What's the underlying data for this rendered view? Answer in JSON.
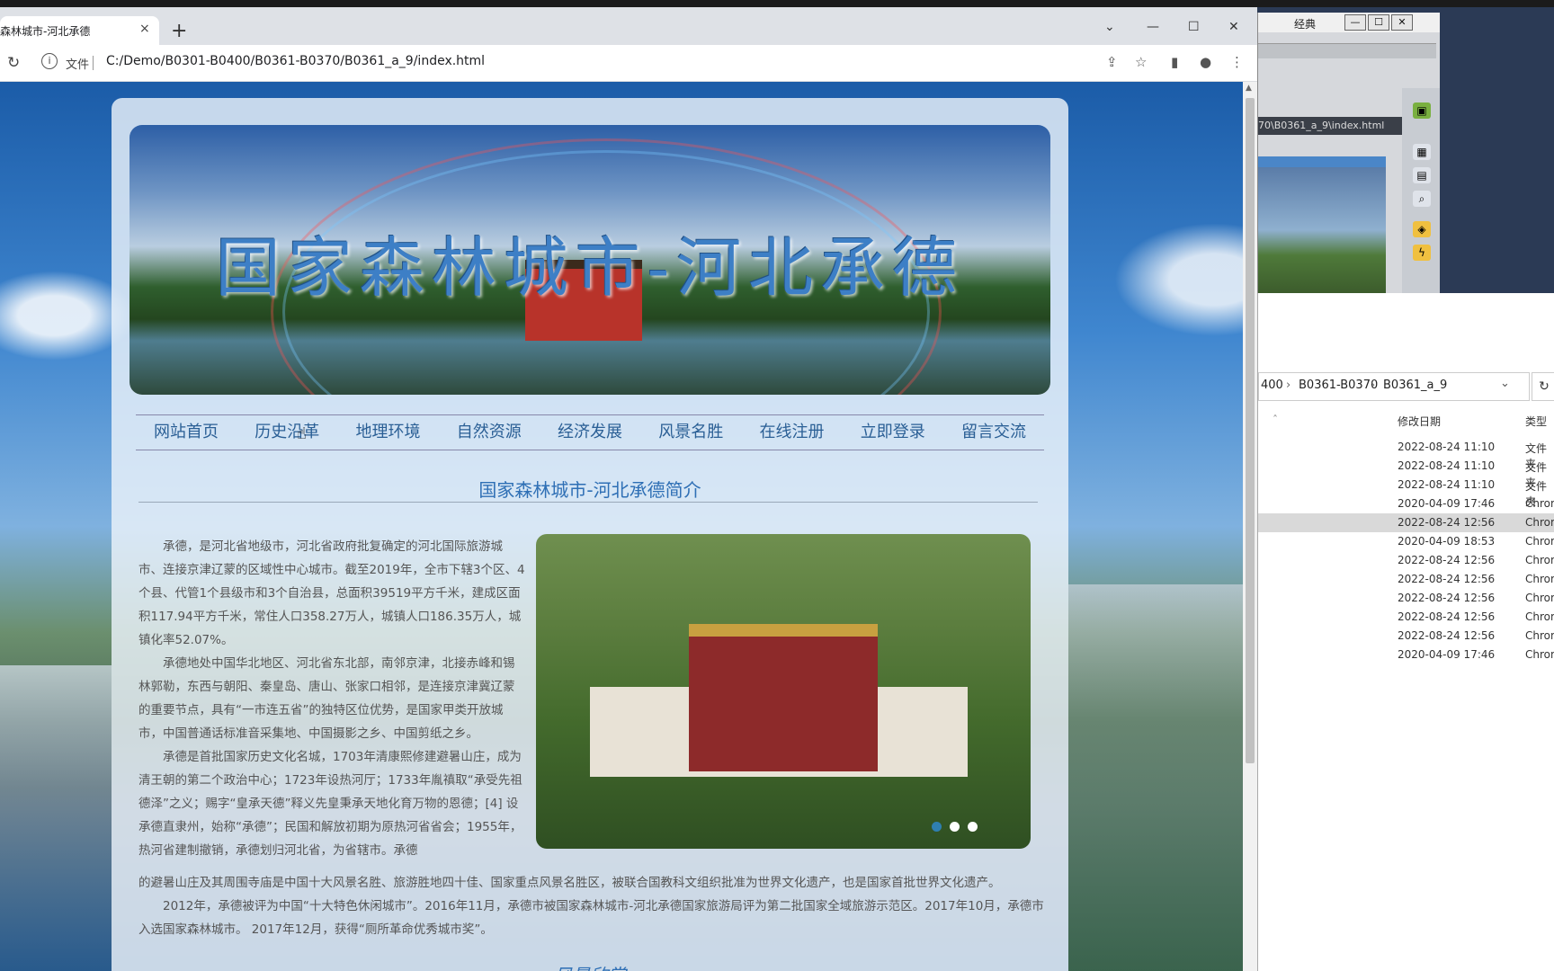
{
  "browser": {
    "tab_title": "森林城市-河北承德",
    "tab_close": "×",
    "new_tab": "+",
    "scheme_label": "文件",
    "url": "C:/Demo/B0301-B0400/B0361-B0370/B0361_a_9/index.html"
  },
  "window_controls": {
    "dropdown": "⌄",
    "minimize": "—",
    "maximize": "☐",
    "close": "✕"
  },
  "site": {
    "banner_title": "国家森林城市-河北承德",
    "nav": [
      "网站首页",
      "历史沿革",
      "地理环境",
      "自然资源",
      "经济发展",
      "风景名胜",
      "在线注册",
      "立即登录",
      "留言交流"
    ],
    "intro_title": "国家森林城市-河北承德简介",
    "paragraphs": [
      "承德，是河北省地级市，河北省政府批复确定的河北国际旅游城市、连接京津辽蒙的区域性中心城市。截至2019年，全市下辖3个区、4个县、代管1个县级市和3个自治县，总面积39519平方千米，建成区面积117.94平方千米，常住人口358.27万人，城镇人口186.35万人，城镇化率52.07%。",
      "承德地处中国华北地区、河北省东北部，南邻京津，北接赤峰和锡林郭勒，东西与朝阳、秦皇岛、唐山、张家口相邻，是连接京津冀辽蒙的重要节点，具有“一市连五省”的独特区位优势，是国家甲类开放城市，中国普通话标准音采集地、中国摄影之乡、中国剪纸之乡。",
      "承德是首批国家历史文化名城，1703年清康熙修建避暑山庄，成为清王朝的第二个政治中心；1723年设热河厅；1733年胤禛取“承受先祖德泽”之义；赐字“皇承天德”释义先皇秉承天地化育万物的恩德；[4] 设承德直隶州，始称“承德”；民国和解放初期为原热河省省会；1955年，热河省建制撤销，承德划归河北省，为省辖市。承德"
    ],
    "paragraph_cont": "的避暑山庄及其周围寺庙是中国十大风景名胜、旅游胜地四十佳、国家重点风景名胜区，被联合国教科文组织批准为世界文化遗产，也是国家首批世界文化遗产。",
    "paragraph_last": "　　2012年，承德被评为中国“十大特色休闲城市”。2016年11月，承德市被国家森林城市-河北承德国家旅游局评为第二批国家全域旅游示范区。2017年10月，承德市入选国家森林城市。 2017年12月，获得“厕所革命优秀城市奖”。",
    "gallery_title": "风景欣赏"
  },
  "dreamweaver": {
    "menu": "经典",
    "path": "70\\B0361_a_9\\index.html"
  },
  "explorer": {
    "breadcrumb": [
      "400",
      "B0361-B0370",
      "B0361_a_9"
    ],
    "col_date": "修改日期",
    "col_type": "类型",
    "rows": [
      {
        "date": "2022-08-24 11:10",
        "type": "文件夹"
      },
      {
        "date": "2022-08-24 11:10",
        "type": "文件夹"
      },
      {
        "date": "2022-08-24 11:10",
        "type": "文件夹"
      },
      {
        "date": "2020-04-09 17:46",
        "type": "Chrom"
      },
      {
        "date": "2022-08-24 12:56",
        "type": "Chrom"
      },
      {
        "date": "2020-04-09 18:53",
        "type": "Chrom"
      },
      {
        "date": "2022-08-24 12:56",
        "type": "Chrom"
      },
      {
        "date": "2022-08-24 12:56",
        "type": "Chrom"
      },
      {
        "date": "2022-08-24 12:56",
        "type": "Chrom"
      },
      {
        "date": "2022-08-24 12:56",
        "type": "Chrom"
      },
      {
        "date": "2022-08-24 12:56",
        "type": "Chrom"
      },
      {
        "date": "2020-04-09 17:46",
        "type": "Chrom"
      }
    ]
  }
}
